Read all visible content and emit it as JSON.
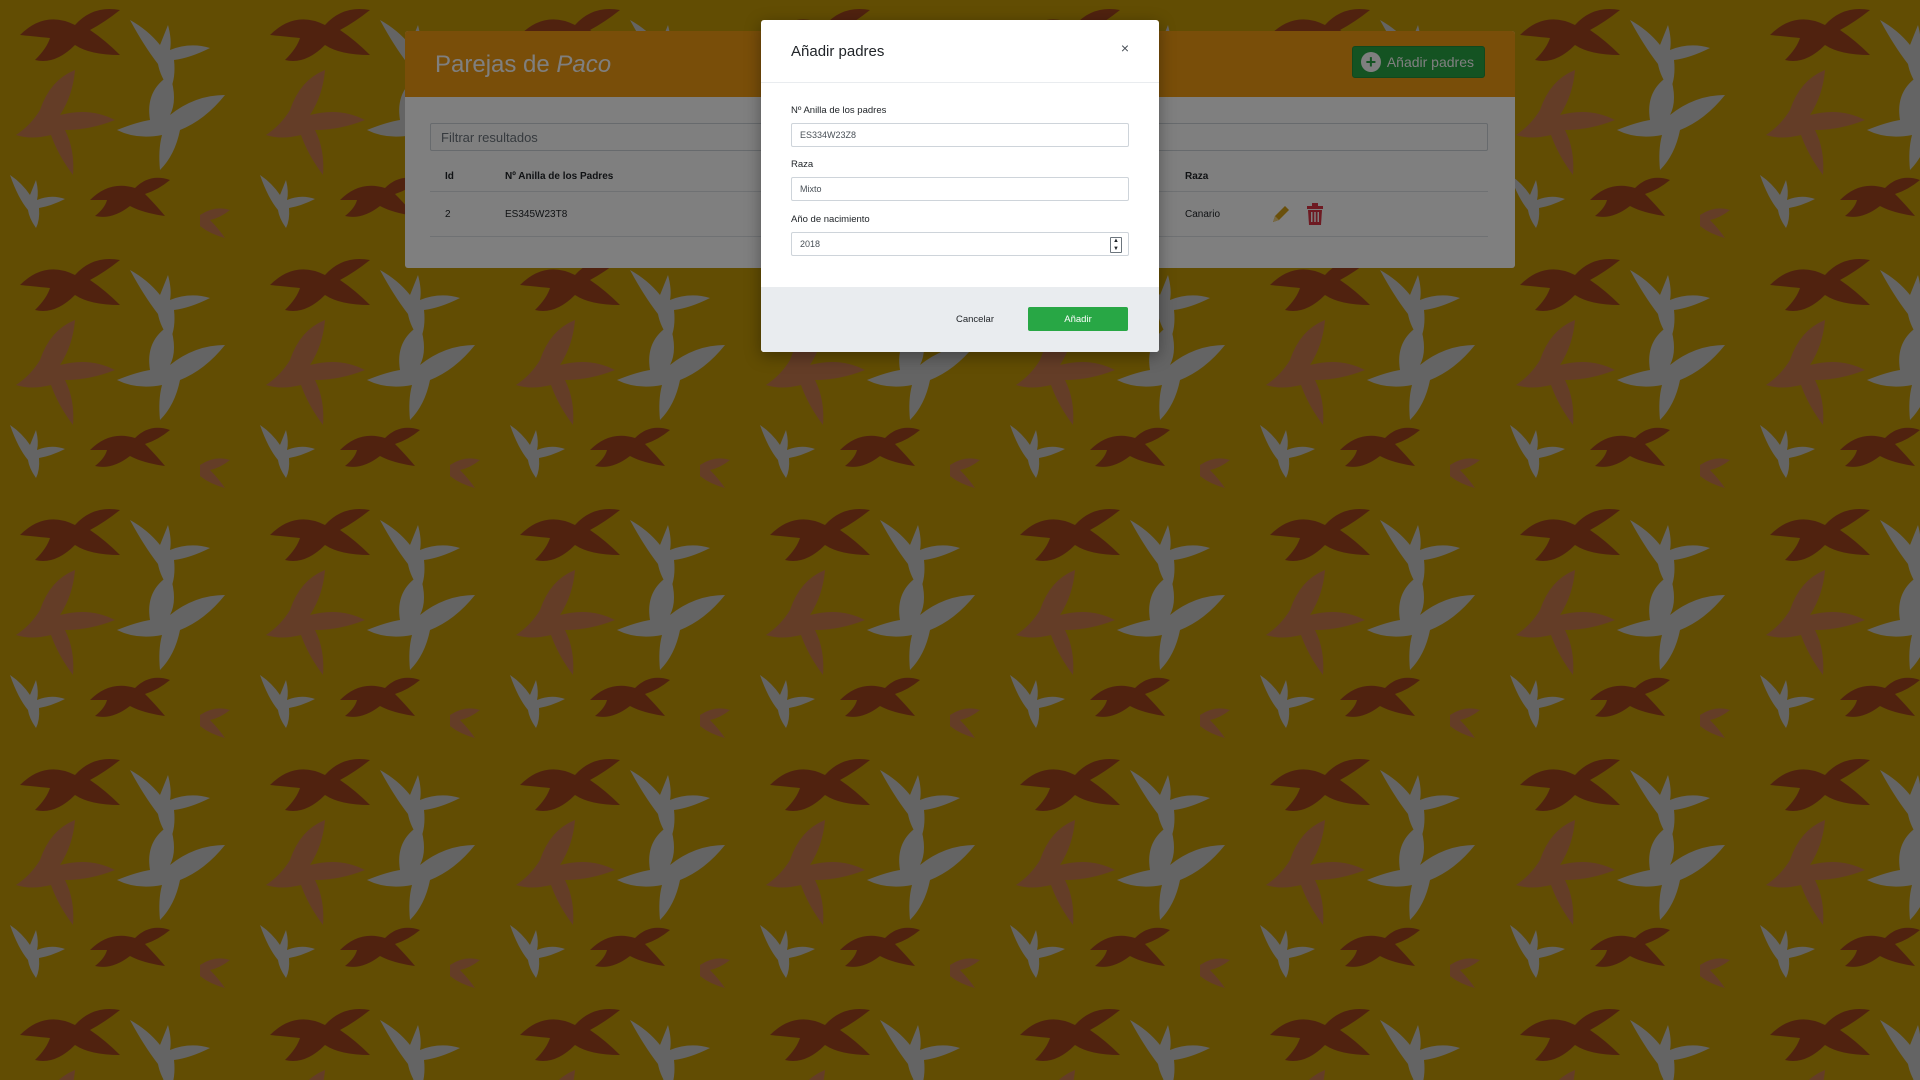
{
  "page": {
    "title_prefix": "Parejas de",
    "title_name": "Paco",
    "add_parents_button": "Añadir padres",
    "filter_placeholder": "Filtrar resultados",
    "table": {
      "columns": [
        "Id",
        "Nº Anilla de los Padres",
        "Raza"
      ],
      "rows": [
        {
          "id": "2",
          "ring": "ES345W23T8",
          "breed": "Canario"
        }
      ]
    }
  },
  "modal": {
    "title": "Añadir padres",
    "close_symbol": "×",
    "fields": {
      "ring_label": "Nº Anilla de los padres",
      "ring_value": "ES334W23Z8",
      "breed_label": "Raza",
      "breed_value": "Mixto",
      "year_label": "Año de nacimiento",
      "year_value": "2018"
    },
    "cancel_label": "Cancelar",
    "submit_label": "Añadir"
  },
  "colors": {
    "background": "#9a7703",
    "header": "#f39c12",
    "primary_green": "#28a745",
    "bird_brown": "#a0441f",
    "bird_tan": "#c87a4f",
    "bird_grey": "#c9c9c9",
    "delete_red": "#dc3545",
    "edit_yellow": "#d4a017"
  },
  "icons": {
    "add": "plus-circle-icon",
    "edit": "pencil-icon",
    "delete": "trash-icon",
    "close": "close-icon",
    "spinner": "spinner-arrows-icon"
  }
}
